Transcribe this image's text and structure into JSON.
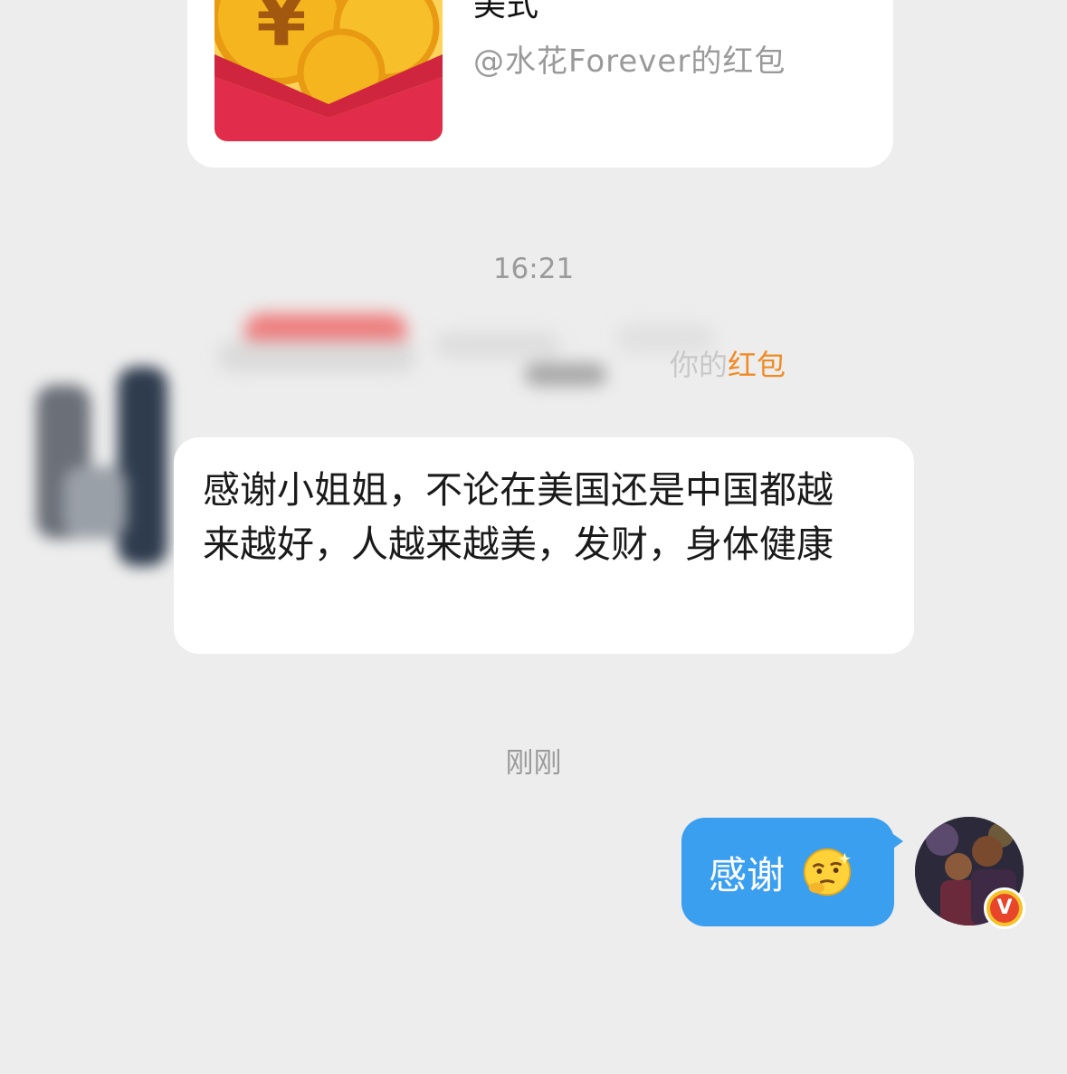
{
  "red_packet": {
    "title": "美式",
    "from": "@水花Forever的红包",
    "image_icon": "red-envelope-coins-icon"
  },
  "timestamps": {
    "first": "16:21",
    "second": "刚刚"
  },
  "notice": {
    "suffix_text": "你的",
    "link_text": "红包"
  },
  "messages": {
    "incoming": "感谢小姐姐，不论在美国还是中国都越来越好，人越来越美，发财，身体健康",
    "outgoing": "感谢"
  },
  "colors": {
    "background": "#ededed",
    "outgoing_bubble": "#3b9ff0",
    "link_orange": "#f08a24",
    "packet_red": "#e12d4b"
  },
  "verified_badge": "V"
}
